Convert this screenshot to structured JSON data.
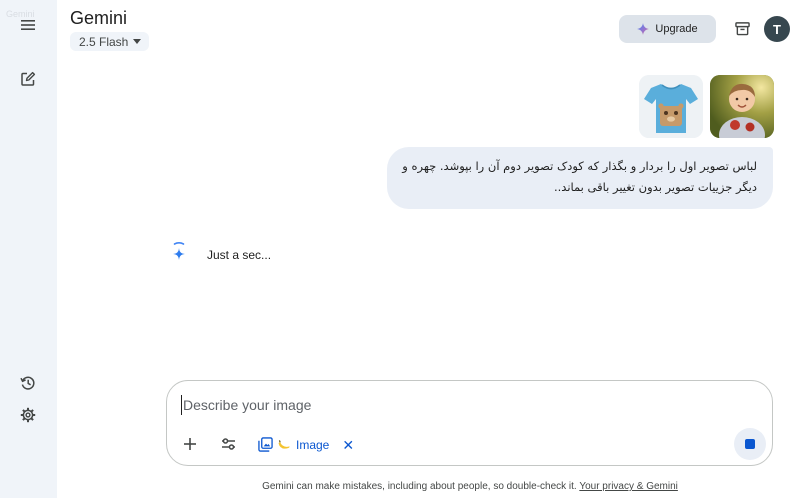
{
  "sidebar": {
    "ghost_label": "Gemini",
    "menu_icon": "hamburger-menu-icon",
    "new_chat_icon": "edit-square-icon",
    "activity_icon": "history-icon",
    "settings_icon": "gear-icon"
  },
  "header": {
    "title": "Gemini",
    "model": "2.5 Flash",
    "upgrade_label": "Upgrade",
    "archive_icon": "archive-box-icon",
    "avatar_initial": "T"
  },
  "chat": {
    "attachments": [
      {
        "name": "blue-t-shirt-image"
      },
      {
        "name": "child-photo-image"
      }
    ],
    "user_message": "لباس تصویر اول را بردار و بگذار که کودک تصویر دوم آن را بپوشد. چهره و دیگر جزییات تصویر بدون تغییر باقی بماند..",
    "assistant_status": "Just a sec..."
  },
  "composer": {
    "placeholder": "Describe your image",
    "value": "",
    "add_icon": "plus-icon",
    "tools_icon": "sliders-icon",
    "chip_label": "Image",
    "chip_icon": "image-gallery-icon",
    "chip_extra_icon": "banana-icon",
    "chip_close": "✕",
    "stop_icon": "stop-square-icon"
  },
  "footer": {
    "disclaimer": "Gemini can make mistakes, including about people, so double-check it.",
    "privacy_link": "Your privacy & Gemini"
  },
  "colors": {
    "sidebar_bg": "#f0f4f9",
    "accent_blue": "#0b57d0",
    "bubble_bg": "#e9eef6",
    "upgrade_bg": "#dde3ea",
    "avatar_bg": "#37474f"
  }
}
